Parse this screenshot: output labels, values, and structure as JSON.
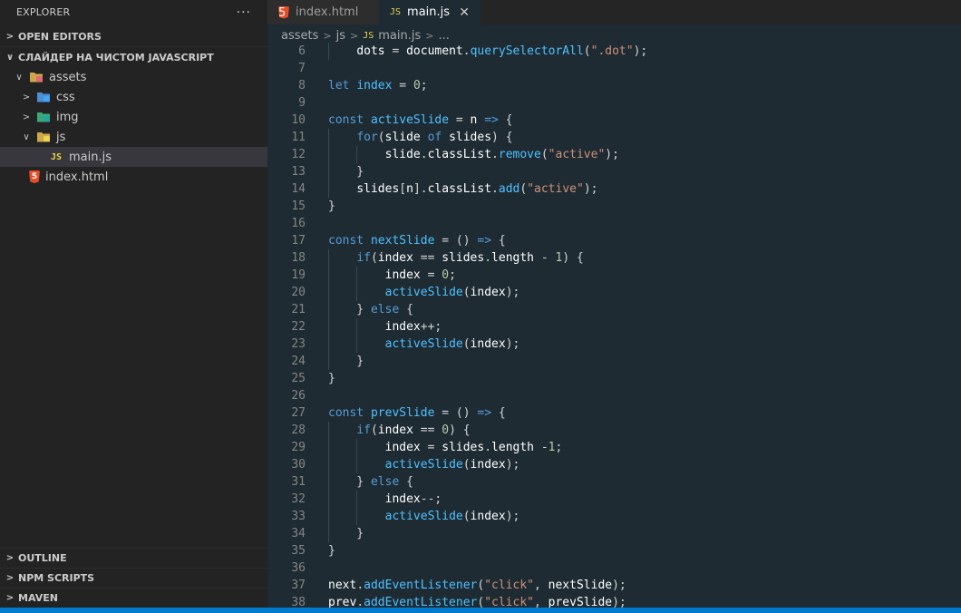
{
  "sidebar": {
    "title": "EXPLORER",
    "more": "···",
    "open_editors": "OPEN EDITORS",
    "project": "СЛАЙДЕР НА ЧИСТОМ JAVASCRIPT",
    "tree": [
      {
        "label": "assets",
        "depth": 1,
        "chevron": "∨",
        "icon": "folder-assets-icon"
      },
      {
        "label": "css",
        "depth": 2,
        "chevron": ">",
        "icon": "folder-css-icon"
      },
      {
        "label": "img",
        "depth": 2,
        "chevron": ">",
        "icon": "folder-img-icon"
      },
      {
        "label": "js",
        "depth": 2,
        "chevron": "∨",
        "icon": "folder-js-icon"
      },
      {
        "label": "main.js",
        "depth": 3,
        "chevron": "",
        "icon": "js-file-icon"
      },
      {
        "label": "index.html",
        "depth": 1,
        "chevron": "",
        "icon": "html-file-icon"
      }
    ],
    "bottom_sections": [
      "OUTLINE",
      "NPM SCRIPTS",
      "MAVEN"
    ]
  },
  "tabs": [
    {
      "label": "index.html",
      "icon": "html-file-icon",
      "active": false
    },
    {
      "label": "main.js",
      "icon": "js-file-icon",
      "active": true,
      "close": "✕"
    }
  ],
  "breadcrumb": [
    "assets",
    "js",
    "main.js",
    "..."
  ],
  "js_badge": "JS",
  "html_badge": "5",
  "code": {
    "first_line": 6,
    "lines": [
      "    dots = document.querySelectorAll(\".dot\");",
      "",
      "let index = 0;",
      "",
      "const activeSlide = n => {",
      "    for(slide of slides) {",
      "        slide.classList.remove(\"active\");",
      "    }",
      "    slides[n].classList.add(\"active\");",
      "}",
      "",
      "const nextSlide = () => {",
      "    if(index == slides.length - 1) {",
      "        index = 0;",
      "        activeSlide(index);",
      "    } else {",
      "        index++;",
      "        activeSlide(index);",
      "    }",
      "}",
      "",
      "const prevSlide = () => {",
      "    if(index == 0) {",
      "        index = slides.length -1;",
      "        activeSlide(index);",
      "    } else {",
      "        index--;",
      "        activeSlide(index);",
      "    }",
      "}",
      "",
      "next.addEventListener(\"click\", nextSlide);",
      "prev.addEventListener(\"click\", prevSlide);"
    ]
  },
  "colors": {
    "editor_bg": "#1e2b33",
    "sidebar_bg": "#232323",
    "keyword": "#569cd6",
    "function": "#4fc1ff",
    "string": "#ce9178",
    "number": "#b5cea8",
    "status_bar": "#007acc"
  }
}
